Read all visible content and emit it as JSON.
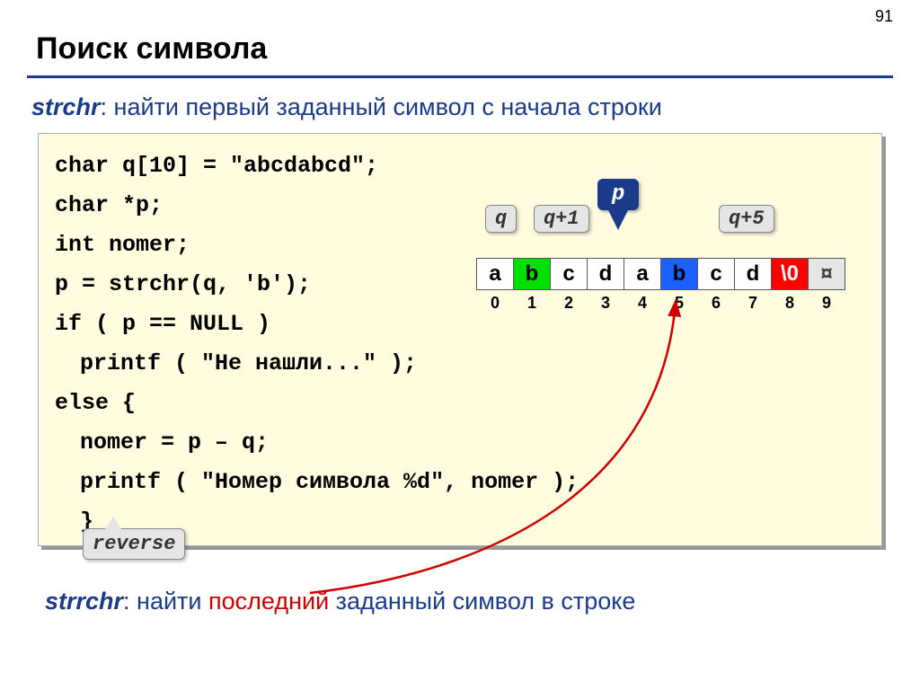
{
  "pageNumber": "91",
  "title": "Поиск символа",
  "desc1": {
    "fn": "strchr",
    "text": ": найти первый заданный символ c начала строки"
  },
  "code": {
    "l1": "char q[10] = \"abcdabcd\";",
    "l2": "char *p;",
    "l3": "int nomer;",
    "l4": "p = strchr(q, 'b');",
    "l5": "if ( p == NULL )",
    "l6": "printf ( \"Не нашли...\" );",
    "l7": "else {",
    "l8": "nomer = p – q;",
    "l9": "printf ( \"Номер символа %d\", nomer );",
    "l10": "}"
  },
  "pointers": {
    "q": "q",
    "qp1": "q+1",
    "p": "p",
    "qp5": "q+5"
  },
  "cells": [
    "a",
    "b",
    "c",
    "d",
    "a",
    "b",
    "c",
    "d",
    "\\0",
    "¤"
  ],
  "indices": [
    "0",
    "1",
    "2",
    "3",
    "4",
    "5",
    "6",
    "7",
    "8",
    "9"
  ],
  "reverse": "reverse",
  "desc2": {
    "fn": "strrchr",
    "pre": ": найти ",
    "red": "последний",
    "post": " заданный символ в строке"
  }
}
